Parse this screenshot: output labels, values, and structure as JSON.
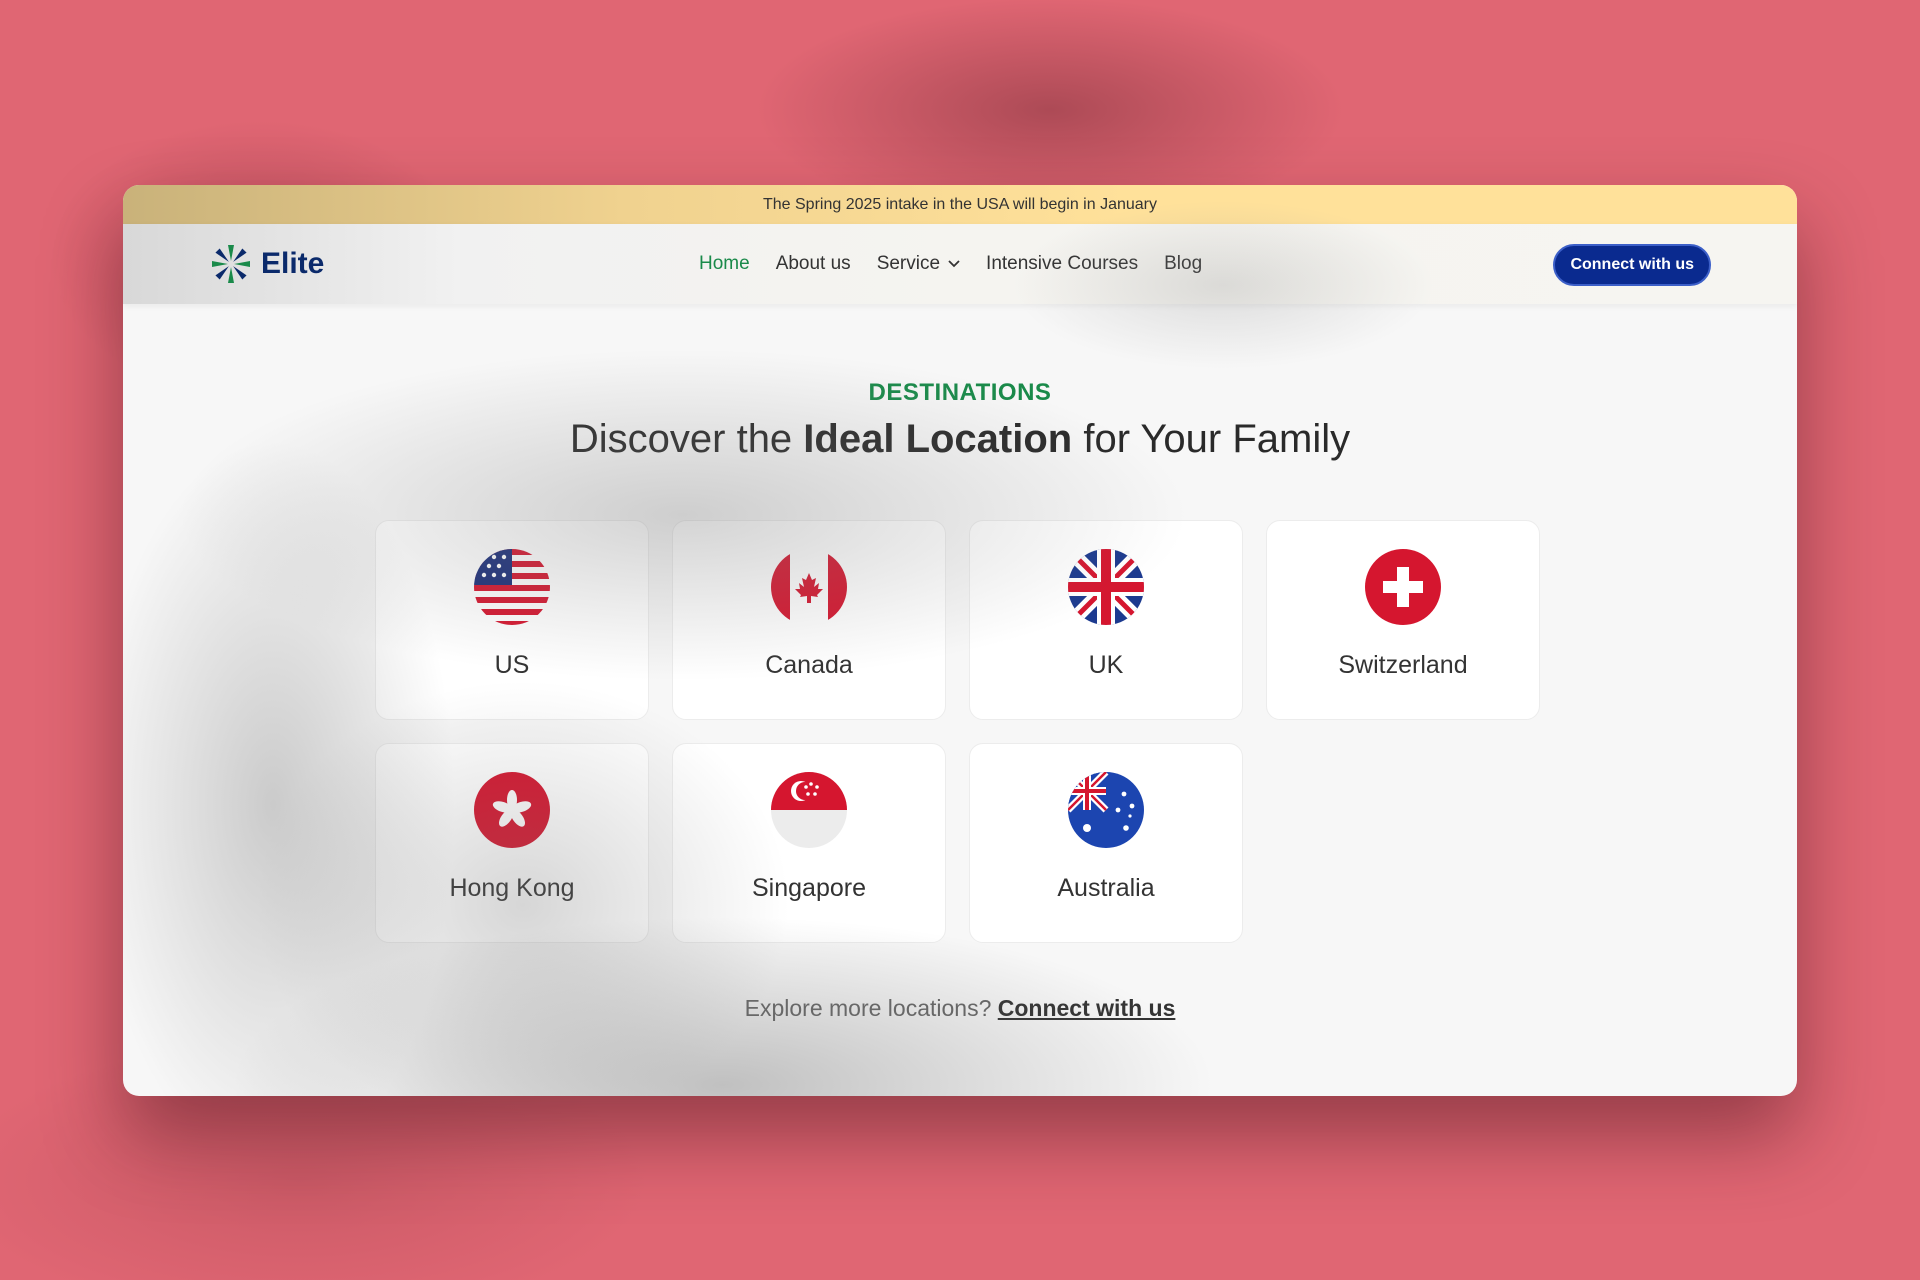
{
  "announcement": "The Spring 2025 intake in the USA will begin in January",
  "nav": {
    "brand": "Elite",
    "items": [
      {
        "label": "Home",
        "active": true
      },
      {
        "label": "About us",
        "active": false
      },
      {
        "label": "Service",
        "active": false,
        "dropdown": true
      },
      {
        "label": "Intensive Courses",
        "active": false
      },
      {
        "label": "Blog",
        "active": false
      }
    ],
    "cta": "Connect with us"
  },
  "section": {
    "eyebrow": "DESTINATIONS",
    "headline_pre": "Discover the ",
    "headline_bold": "Ideal Location",
    "headline_post": " for Your Family"
  },
  "destinations": [
    {
      "label": "US",
      "icon": "us-flag-icon"
    },
    {
      "label": "Canada",
      "icon": "canada-flag-icon"
    },
    {
      "label": "UK",
      "icon": "uk-flag-icon"
    },
    {
      "label": "Switzerland",
      "icon": "switzerland-flag-icon"
    },
    {
      "label": "Hong Kong",
      "icon": "hong-kong-flag-icon"
    },
    {
      "label": "Singapore",
      "icon": "singapore-flag-icon"
    },
    {
      "label": "Australia",
      "icon": "australia-flag-icon"
    }
  ],
  "footer": {
    "prompt": "Explore more locations?",
    "link": "Connect with us"
  },
  "colors": {
    "accent_green": "#1a8a4a",
    "brand_navy": "#0b2a6b",
    "cta_blue": "#0a2a8f",
    "announcement_bar": "#ffe19a",
    "backdrop": "#e06673"
  }
}
